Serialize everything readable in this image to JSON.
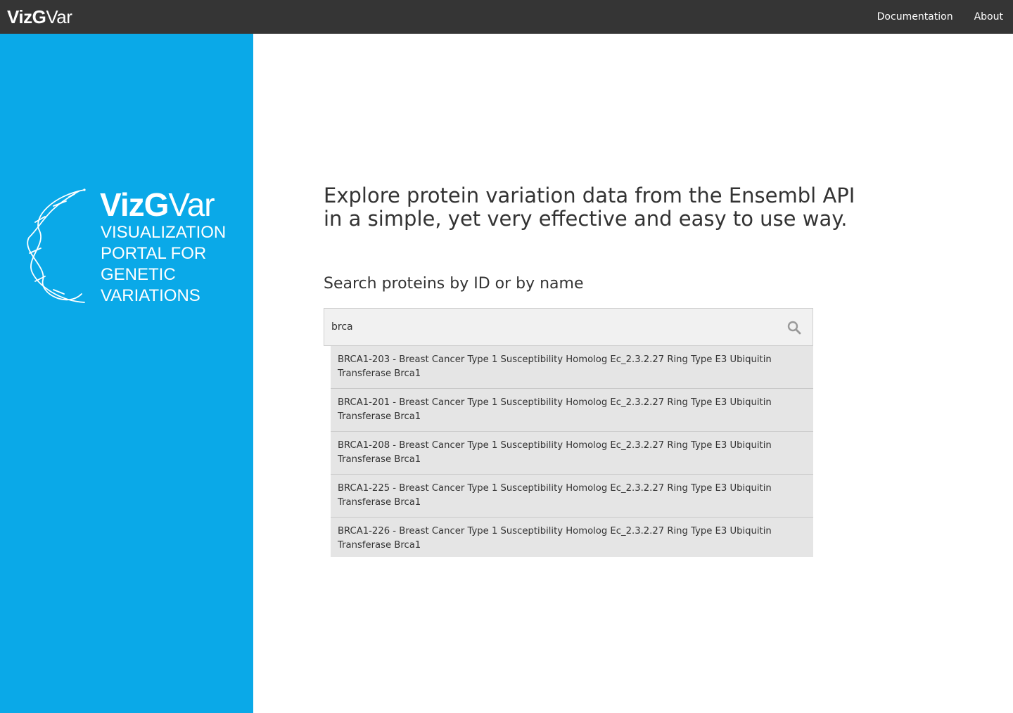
{
  "topbar": {
    "brand_bold": "VizG",
    "brand_light": "Var",
    "nav": [
      {
        "label": "Documentation"
      },
      {
        "label": "About"
      }
    ]
  },
  "sidebar": {
    "logo_bold": "VizG",
    "logo_light": "Var",
    "logo_subtitle_lines": [
      "VISUALIZATION",
      "PORTAL FOR",
      "GENETIC",
      "VARIATIONS"
    ]
  },
  "main": {
    "headline": "Explore protein variation data from the Ensembl API in a simple, yet very effective and easy to use way.",
    "search_label": "Search proteins by ID or by name",
    "search_value": "brca",
    "search_icon": "search-icon",
    "suggestions": [
      {
        "text": "BRCA1-203 - Breast Cancer Type 1 Susceptibility Homolog Ec_2.3.2.27 Ring Type E3 Ubiquitin Transferase Brca1"
      },
      {
        "text": "BRCA1-201 - Breast Cancer Type 1 Susceptibility Homolog Ec_2.3.2.27 Ring Type E3 Ubiquitin Transferase Brca1"
      },
      {
        "text": "BRCA1-208 - Breast Cancer Type 1 Susceptibility Homolog Ec_2.3.2.27 Ring Type E3 Ubiquitin Transferase Brca1"
      },
      {
        "text": "BRCA1-225 - Breast Cancer Type 1 Susceptibility Homolog Ec_2.3.2.27 Ring Type E3 Ubiquitin Transferase Brca1"
      },
      {
        "text": "BRCA1-226 - Breast Cancer Type 1 Susceptibility Homolog Ec_2.3.2.27 Ring Type E3 Ubiquitin Transferase Brca1"
      }
    ]
  },
  "colors": {
    "topbar": "#353535",
    "sidebar": "#0aa9e8",
    "suggestion_bg": "#e5e5e5"
  }
}
